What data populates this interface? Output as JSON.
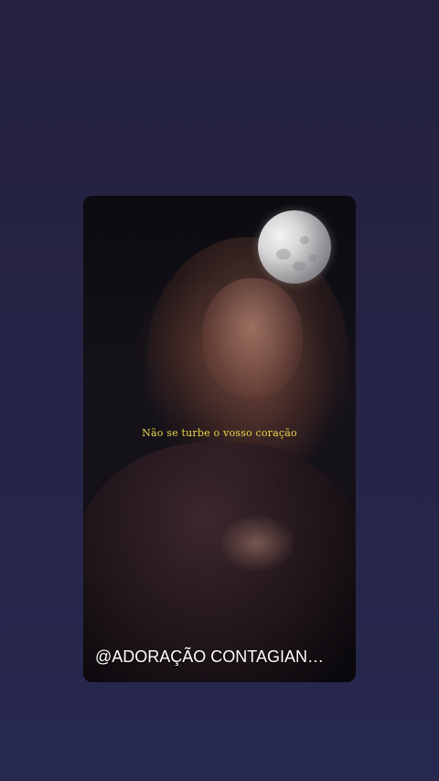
{
  "video": {
    "lyric": "Não se turbe o vosso coração",
    "handle": "@ADORAÇÃO CONTAGIAN…",
    "overlay_icon": "moon-icon"
  },
  "colors": {
    "background": "#262446",
    "lyric": "#e9d64c",
    "handle": "#ffffff"
  }
}
